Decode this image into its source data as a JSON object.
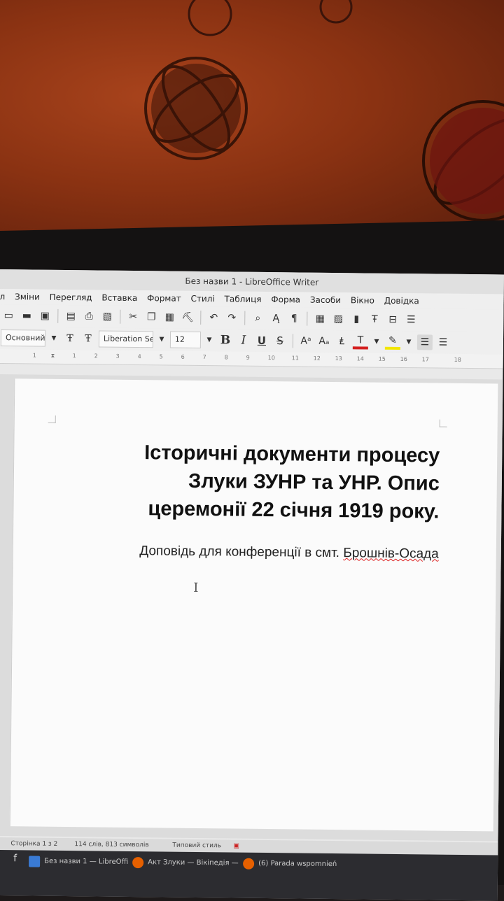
{
  "window": {
    "title": "Без назви 1 - LibreOffice Writer"
  },
  "menu": [
    "л",
    "Зміни",
    "Перегляд",
    "Вставка",
    "Формат",
    "Стилі",
    "Таблиця",
    "Форма",
    "Засоби",
    "Вікно",
    "Довідка"
  ],
  "format_toolbar": {
    "paragraph_style": "Основний т",
    "font_name": "Liberation Se",
    "font_size": "12",
    "bold": "B",
    "italic": "I",
    "underline": "U",
    "strike": "S"
  },
  "ruler": [
    "1",
    "1",
    "2",
    "3",
    "4",
    "5",
    "6",
    "7",
    "8",
    "9",
    "10",
    "11",
    "12",
    "13",
    "14",
    "15",
    "16",
    "17",
    "18"
  ],
  "document": {
    "title_lines": [
      "Історичні документи процесу",
      "Злуки ЗУНР та УНР. Опис",
      "церемонії 22 січня 1919 року."
    ],
    "subtitle_main": "Доповідь для конференції в смт. ",
    "subtitle_misspelled": "Брошнів-Осада"
  },
  "statusbar": {
    "page": "Сторінка 1 з 2",
    "words": "114 слів, 813 символів",
    "style": "Типовий стиль"
  },
  "taskbar": [
    "Без назви 1 — LibreOffi",
    "Акт Злуки — Вікіпедія —",
    "(6) Parada wspomnień"
  ],
  "colors": {
    "wall": "#8a3212",
    "font_color_bar": "#d42020",
    "highlight_bar": "#f2e600"
  }
}
